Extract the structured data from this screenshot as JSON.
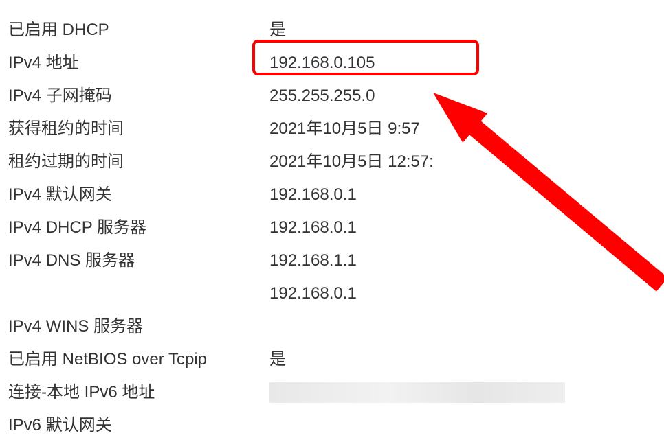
{
  "rows": [
    {
      "label": "已启用 DHCP",
      "value": "是"
    },
    {
      "label": "IPv4 地址",
      "value": "192.168.0.105"
    },
    {
      "label": "IPv4 子网掩码",
      "value": "255.255.255.0"
    },
    {
      "label": "获得租约的时间",
      "value": "2021年10月5日 9:57"
    },
    {
      "label": "租约过期的时间",
      "value": "2021年10月5日 12:57:"
    },
    {
      "label": "IPv4 默认网关",
      "value": "192.168.0.1"
    },
    {
      "label": "IPv4 DHCP 服务器",
      "value": "192.168.0.1"
    },
    {
      "label": "IPv4 DNS 服务器",
      "value": "192.168.1.1"
    },
    {
      "label": "",
      "value": "192.168.0.1"
    },
    {
      "label": "IPv4 WINS 服务器",
      "value": ""
    },
    {
      "label": "已启用 NetBIOS over Tcpip",
      "value": "是"
    },
    {
      "label": "连接-本地 IPv6 地址",
      "value": "",
      "redacted": true
    },
    {
      "label": "IPv6 默认网关",
      "value": ""
    }
  ],
  "annotation": {
    "highlight_color": "#ff0000"
  }
}
